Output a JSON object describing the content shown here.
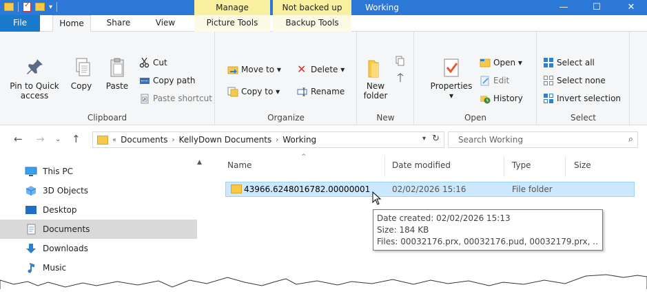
{
  "window": {
    "title": "Working",
    "context_manage": "Manage",
    "context_backup": "Not backed up",
    "min": "—",
    "max": "☐",
    "close": "✕"
  },
  "tabs": {
    "file": "File",
    "home": "Home",
    "share": "Share",
    "view": "View",
    "picture_tools": "Picture Tools",
    "backup_tools": "Backup Tools"
  },
  "ribbon": {
    "clipboard": {
      "label": "Clipboard",
      "pin_line1": "Pin to Quick",
      "pin_line2": "access",
      "copy": "Copy",
      "paste": "Paste",
      "cut": "Cut",
      "copy_path": "Copy path",
      "paste_shortcut": "Paste shortcut"
    },
    "organize": {
      "label": "Organize",
      "move_to": "Move to ▾",
      "copy_to": "Copy to ▾",
      "delete": "Delete ▾",
      "rename": "Rename"
    },
    "new": {
      "label": "New",
      "new_folder_line1": "New",
      "new_folder_line2": "folder"
    },
    "open": {
      "label": "Open",
      "properties": "Properties",
      "open": "Open ▾",
      "edit": "Edit",
      "history": "History"
    },
    "select": {
      "label": "Select",
      "select_all": "Select all",
      "select_none": "Select none",
      "invert": "Invert selection"
    }
  },
  "address": {
    "overflow": "«",
    "crumbs": [
      "Documents",
      "KellyDown Documents",
      "Working"
    ],
    "search_placeholder": "Search Working"
  },
  "nav": {
    "items": [
      "This PC",
      "3D Objects",
      "Desktop",
      "Documents",
      "Downloads",
      "Music"
    ]
  },
  "columns": {
    "name": "Name",
    "date": "Date modified",
    "type": "Type",
    "size": "Size"
  },
  "files": [
    {
      "name": "43966.6248016782.00000001",
      "date": "02/02/2026 15:16",
      "type": "File folder"
    }
  ],
  "tooltip": {
    "created": "Date created: 02/02/2026 15:13",
    "size": "Size: 184 KB",
    "files": "Files: 00032176.prx, 00032176.pud, 00032179.prx, ..."
  },
  "colors": {
    "titlebar": "#2b78d6",
    "file_tab": "#1979ca",
    "context_tab": "#f8f09e",
    "selection": "#cce8ff",
    "folder": "#f6c94a"
  }
}
